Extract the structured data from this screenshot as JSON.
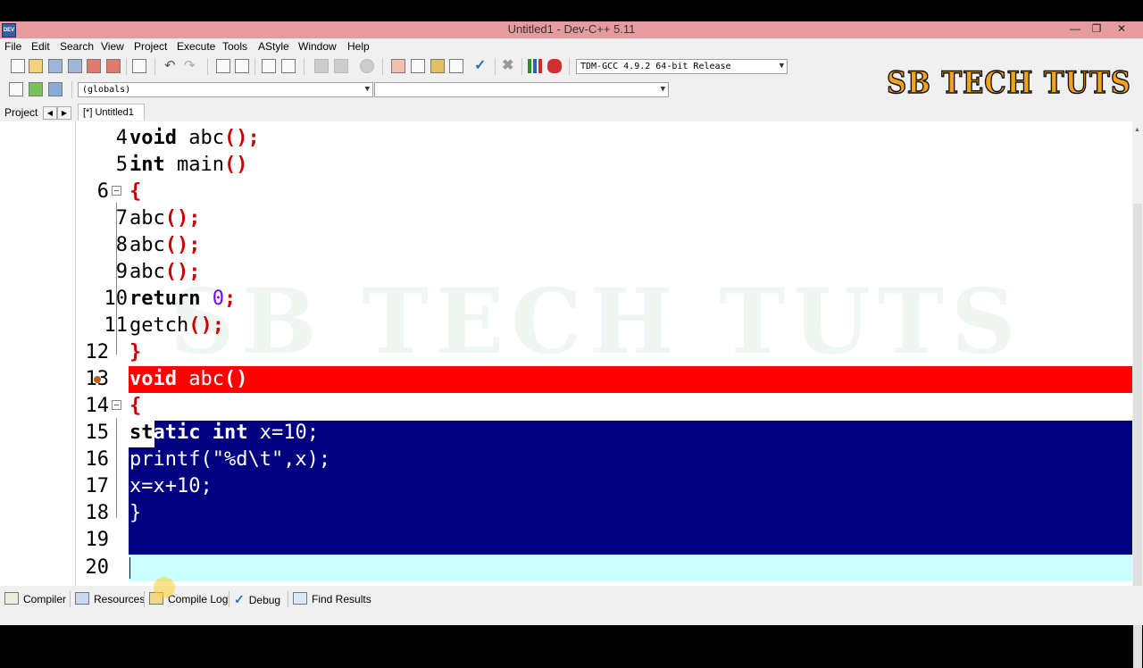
{
  "window": {
    "title": "Untitled1 - Dev-C++ 5.11",
    "icon_text": "DEV"
  },
  "menu": [
    "File",
    "Edit",
    "Search",
    "View",
    "Project",
    "Execute",
    "Tools",
    "AStyle",
    "Window",
    "Help"
  ],
  "toolbar": {
    "compiler_select": "TDM-GCC 4.9.2 64-bit Release",
    "scope_select": "(globals)",
    "function_select": ""
  },
  "logo": "SB TECH TUTS",
  "watermark": "SB TECH TUTS",
  "left_panel": {
    "tab": "Project"
  },
  "editor": {
    "tab": "[*] Untitled1",
    "lines": [
      {
        "num": "4",
        "text": "void abc();"
      },
      {
        "num": "5",
        "text": "int main()"
      },
      {
        "num": "6",
        "text": "{"
      },
      {
        "num": "7",
        "text": "abc();"
      },
      {
        "num": "8",
        "text": "abc();"
      },
      {
        "num": "9",
        "text": "abc();"
      },
      {
        "num": "10",
        "text": "return 0;"
      },
      {
        "num": "11",
        "text": "getch();"
      },
      {
        "num": "12",
        "text": "}"
      },
      {
        "num": "13",
        "text": "void abc()"
      },
      {
        "num": "14",
        "text": "{"
      },
      {
        "num": "15",
        "text": "static int x=10;"
      },
      {
        "num": "16",
        "text": "printf(\"%d\\t\",x);"
      },
      {
        "num": "17",
        "text": "x=x+10;"
      },
      {
        "num": "18",
        "text": "}"
      },
      {
        "num": "19",
        "text": ""
      },
      {
        "num": "20",
        "text": ""
      }
    ]
  },
  "bottom_tabs": [
    "Compiler",
    "Resources",
    "Compile Log",
    "Debug",
    "Find Results"
  ],
  "colors": {
    "error_line": "#ff0000",
    "selection": "#000080",
    "current_line": "#ccffff",
    "titlebar": "#e69c9e"
  }
}
